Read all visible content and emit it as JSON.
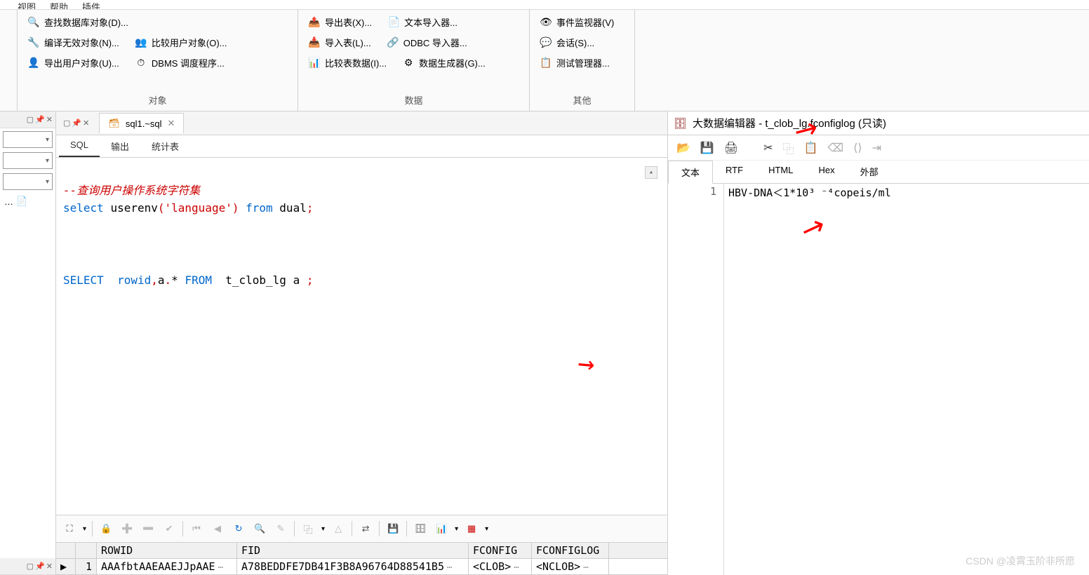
{
  "menubar": {
    "items": [
      "视图",
      "帮助",
      "插件"
    ]
  },
  "ribbon": {
    "groups": [
      {
        "label": "对象",
        "items": [
          {
            "icon": "🔍",
            "text": "查找数据库对象(D)..."
          },
          {
            "icon": "🔧",
            "text": "编译无效对象(N)..."
          },
          {
            "icon": "👤",
            "text": "导出用户对象(U)..."
          },
          {
            "icon": "👥",
            "text": "比较用户对象(O)..."
          },
          {
            "icon": "⏱",
            "text": "DBMS 调度程序..."
          }
        ]
      },
      {
        "label": "数据",
        "items": [
          {
            "icon": "📤",
            "text": "导出表(X)..."
          },
          {
            "icon": "📥",
            "text": "导入表(L)..."
          },
          {
            "icon": "📊",
            "text": "比较表数据(I)..."
          },
          {
            "icon": "📄",
            "text": "文本导入器..."
          },
          {
            "icon": "🔗",
            "text": "ODBC 导入器..."
          },
          {
            "icon": "⚙",
            "text": "数据生成器(G)..."
          }
        ]
      },
      {
        "label": "其他",
        "items": [
          {
            "icon": "👁",
            "text": "事件监视器(V)"
          },
          {
            "icon": "💬",
            "text": "会话(S)..."
          },
          {
            "icon": "📋",
            "text": "测试管理器..."
          }
        ]
      }
    ]
  },
  "file_tab": {
    "name": "sql1.~sql"
  },
  "sql_tabs": [
    "SQL",
    "输出",
    "统计表"
  ],
  "editor": {
    "comment": "--查询用户操作系统字符集",
    "line1": {
      "kw1": "select",
      "fn": "userenv",
      "arg": "'language'",
      "kw2": "from",
      "tbl": "dual"
    },
    "line2": {
      "kw1": "SELECT",
      "col": "rowid",
      "alias": "a",
      "kw2": "FROM",
      "tbl": "t_clob_lg a"
    }
  },
  "grid": {
    "headers": [
      "",
      "",
      "ROWID",
      "FID",
      "FCONFIG",
      "FCONFIGLOG"
    ],
    "row": {
      "marker": "▶",
      "num": "1",
      "rowid": "AAAfbtAAEAAEJJpAAE",
      "fid": "A78BEDDFE7DB41F3B8A96764D88541B5",
      "fconfig": "<CLOB>",
      "fconfiglog": "<NCLOB>"
    }
  },
  "right_panel": {
    "title": "大数据编辑器 - t_clob_lg.fconfiglog (只读)",
    "tabs": [
      "文本",
      "RTF",
      "HTML",
      "Hex",
      "外部"
    ],
    "line_no": "1",
    "content": "HBV-DNA＜1*10³ ⁻⁴copeis/ml"
  },
  "watermark": "CSDN @凌霄玉阶非所愿"
}
